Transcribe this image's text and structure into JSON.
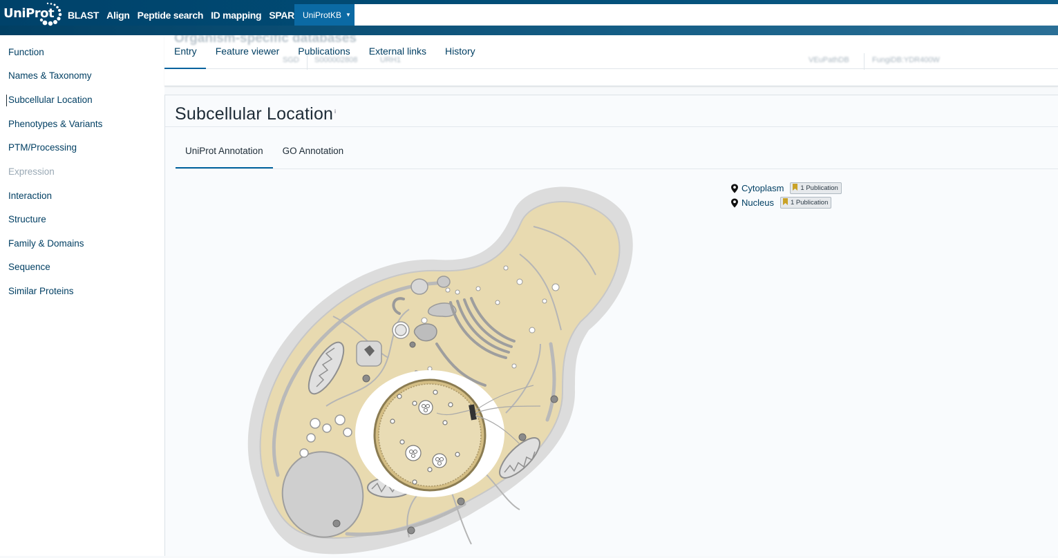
{
  "header": {
    "logo_text": "UniProt",
    "nav": [
      "BLAST",
      "Align",
      "Peptide search",
      "ID mapping",
      "SPARQL"
    ],
    "database": "UniProtKB",
    "search_value": "",
    "search_placeholder": ""
  },
  "sidebar": {
    "items": [
      {
        "label": "Function",
        "state": "normal"
      },
      {
        "label": "Names & Taxonomy",
        "state": "normal"
      },
      {
        "label": "Subcellular Location",
        "state": "active"
      },
      {
        "label": "Phenotypes & Variants",
        "state": "normal"
      },
      {
        "label": "PTM/Processing",
        "state": "normal"
      },
      {
        "label": "Expression",
        "state": "disabled"
      },
      {
        "label": "Interaction",
        "state": "normal"
      },
      {
        "label": "Structure",
        "state": "normal"
      },
      {
        "label": "Family & Domains",
        "state": "normal"
      },
      {
        "label": "Sequence",
        "state": "normal"
      },
      {
        "label": "Similar Proteins",
        "state": "normal"
      }
    ]
  },
  "entry_tabs": {
    "items": [
      "Entry",
      "Feature viewer",
      "Publications",
      "External links",
      "History"
    ],
    "active": "Entry",
    "background_heading": "Organism-specific databases",
    "background_cells": [
      "SGD",
      "S000002808",
      "URH1",
      "VEuPathDB",
      "FungiDB:YDR400W"
    ]
  },
  "section": {
    "title": "Subcellular Location",
    "info_marker": "i",
    "tabs": [
      "UniProt Annotation",
      "GO Annotation"
    ],
    "active_tab": "UniProt Annotation"
  },
  "locations": [
    {
      "name": "Cytoplasm",
      "evidence": "1 Publication",
      "icon": "map-pin-icon"
    },
    {
      "name": "Nucleus",
      "evidence": "1 Publication",
      "icon": "map-pin-icon"
    }
  ],
  "colors": {
    "header_bg": "#00426a",
    "link": "#013f63",
    "accent": "#00629d",
    "cell_cytoplasm": "#e8dab0",
    "cell_wall": "#dcdcdc",
    "bookmark": "#c9a227"
  }
}
